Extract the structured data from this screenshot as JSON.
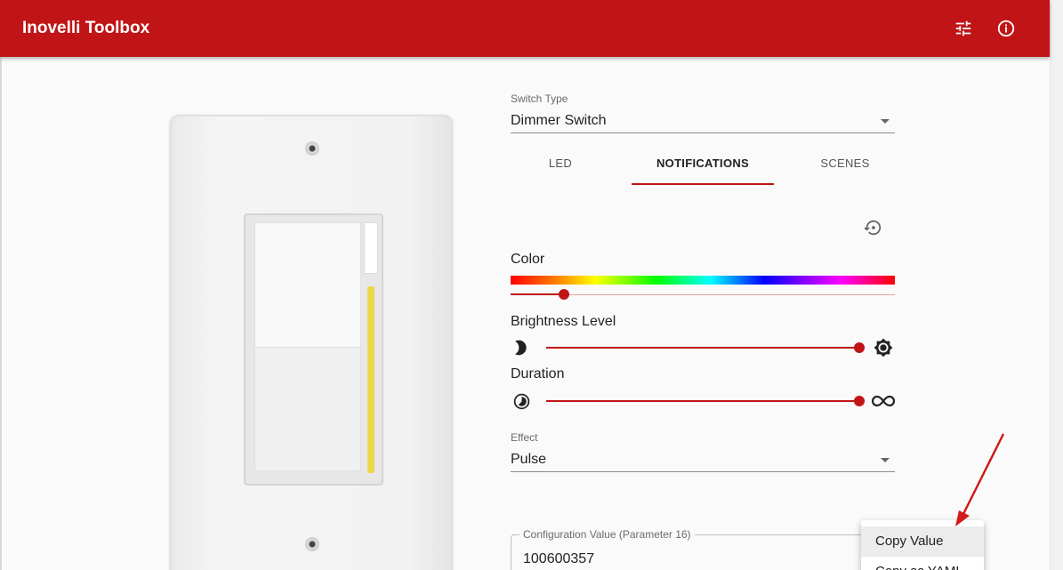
{
  "app": {
    "title": "Inovelli Toolbox"
  },
  "header": {
    "settings_icon": "tune-icon",
    "info_icon": "info-icon"
  },
  "switch_type": {
    "label": "Switch Type",
    "value": "Dimmer Switch"
  },
  "tabs": [
    {
      "label": "LED",
      "active": false
    },
    {
      "label": "NOTIFICATIONS",
      "active": true
    },
    {
      "label": "SCENES",
      "active": false
    }
  ],
  "reset_icon": "restore-icon",
  "color": {
    "label": "Color",
    "value_fraction": 0.14
  },
  "brightness": {
    "label": "Brightness Level",
    "value_fraction": 1.0,
    "min_icon": "moon-icon",
    "max_icon": "brightness-icon"
  },
  "duration": {
    "label": "Duration",
    "value_fraction": 1.0,
    "min_icon": "timelapse-icon",
    "max_icon": "infinity-icon"
  },
  "effect": {
    "label": "Effect",
    "value": "Pulse"
  },
  "config_value": {
    "label": "Configuration Value (Parameter 16)",
    "value": "100600357"
  },
  "context_menu": {
    "items": [
      "Copy Value",
      "Copy as YAML"
    ]
  },
  "colors": {
    "brand": "#c11417",
    "led": "#ecd84b"
  }
}
